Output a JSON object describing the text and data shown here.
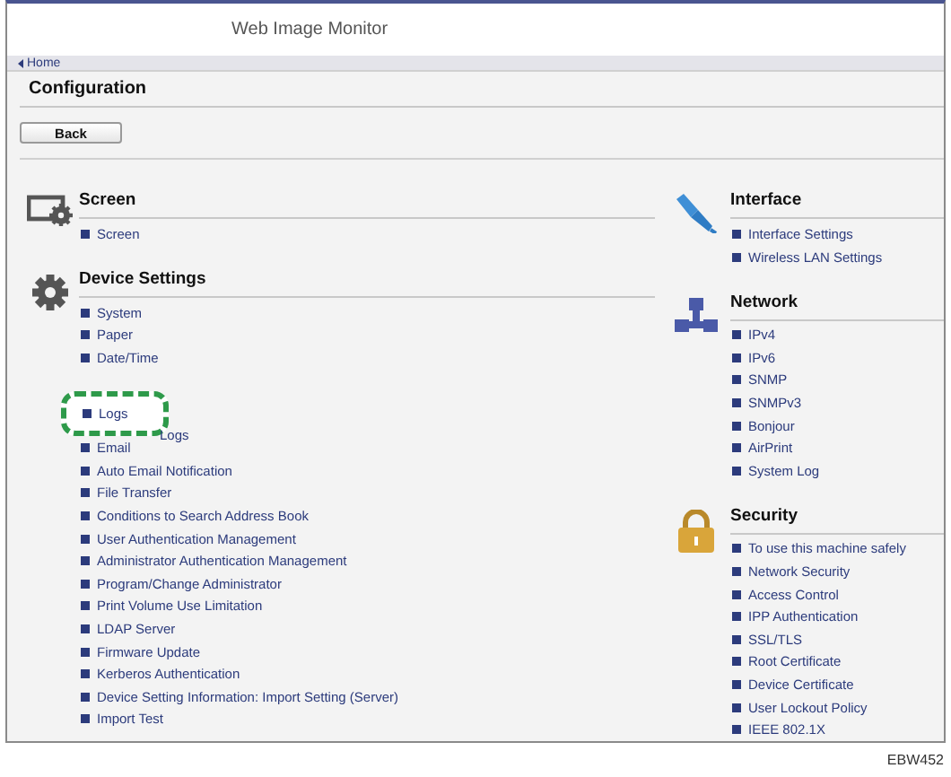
{
  "window": {
    "title": "Web Image Monitor"
  },
  "breadcrumb": {
    "link": "Home"
  },
  "page": {
    "title": "Configuration",
    "back_button": "Back"
  },
  "left_column": [
    {
      "title": "Screen",
      "items": [
        {
          "label": "Screen",
          "highlighted": false
        }
      ]
    },
    {
      "title": "Device Settings",
      "items": [
        {
          "label": "System",
          "highlighted": false
        },
        {
          "label": "Paper",
          "highlighted": false
        },
        {
          "label": "Date/Time",
          "highlighted": false
        },
        {
          "label": "Logs",
          "highlighted": true,
          "callout": "Logs"
        },
        {
          "label": "Email",
          "highlighted": false
        },
        {
          "label": "Auto Email Notification",
          "highlighted": false
        },
        {
          "label": "File Transfer",
          "highlighted": false
        },
        {
          "label": "Conditions to Search Address Book",
          "highlighted": false
        },
        {
          "label": "User Authentication Management",
          "highlighted": false
        },
        {
          "label": "Administrator Authentication Management",
          "highlighted": false
        },
        {
          "label": "Program/Change Administrator",
          "highlighted": false
        },
        {
          "label": "Print Volume Use Limitation",
          "highlighted": false
        },
        {
          "label": "LDAP Server",
          "highlighted": false
        },
        {
          "label": "Firmware Update",
          "highlighted": false
        },
        {
          "label": "Kerberos Authentication",
          "highlighted": false
        },
        {
          "label": "Device Setting Information: Import Setting (Server)",
          "highlighted": false
        },
        {
          "label": "Import Test",
          "highlighted": false
        }
      ]
    }
  ],
  "right_column": [
    {
      "title": "Interface",
      "items": [
        {
          "label": "Interface Settings",
          "highlighted": false
        },
        {
          "label": "Wireless LAN Settings",
          "highlighted": false
        }
      ]
    },
    {
      "title": "Network",
      "items": [
        {
          "label": "IPv4",
          "highlighted": false
        },
        {
          "label": "IPv6",
          "highlighted": false
        },
        {
          "label": "SNMP",
          "highlighted": false
        },
        {
          "label": "SNMPv3",
          "highlighted": false
        },
        {
          "label": "Bonjour",
          "highlighted": false
        },
        {
          "label": "AirPrint",
          "highlighted": false
        },
        {
          "label": "System Log",
          "highlighted": false
        }
      ]
    },
    {
      "title": "Security",
      "items": [
        {
          "label": "To use this machine safely",
          "highlighted": false
        },
        {
          "label": "Network Security",
          "highlighted": false
        },
        {
          "label": "Access Control",
          "highlighted": false
        },
        {
          "label": "IPP Authentication",
          "highlighted": false
        },
        {
          "label": "SSL/TLS",
          "highlighted": false
        },
        {
          "label": "Root Certificate",
          "highlighted": false
        },
        {
          "label": "Device Certificate",
          "highlighted": false
        },
        {
          "label": "User Lockout Policy",
          "highlighted": false
        },
        {
          "label": "IEEE 802.1X",
          "highlighted": false
        }
      ]
    }
  ],
  "figure_code": "EBW452"
}
